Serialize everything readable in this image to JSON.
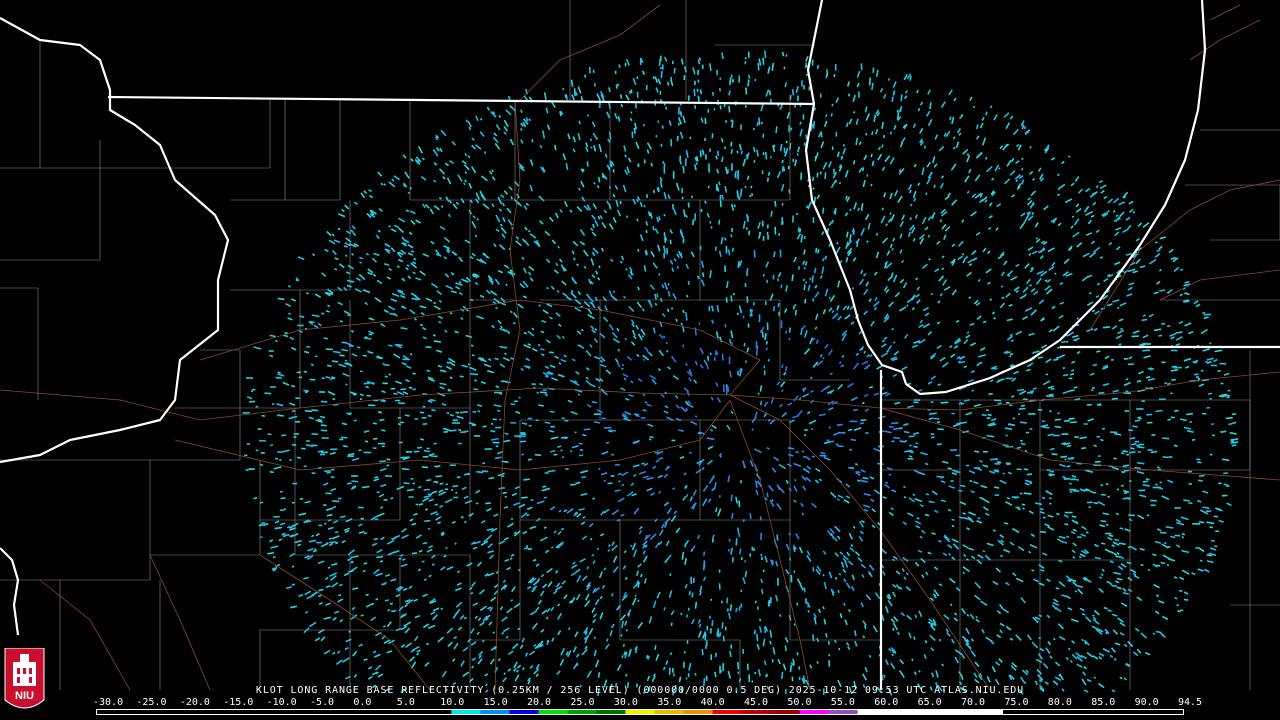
{
  "product": {
    "header": "KLOT LONG RANGE BASE REFLECTIVITY (0.25KM / 256 LEVEL) (000000/0000 0.5 DEG) 2025-10-12 09:53 UTC  ATLAS.NIU.EDU"
  },
  "scale": {
    "labels": [
      "-30.0",
      "-25.0",
      "-20.0",
      "-15.0",
      "-10.0",
      "-5.0",
      "0.0",
      "5.0",
      "10.0",
      "15.0",
      "20.0",
      "25.0",
      "30.0",
      "35.0",
      "40.0",
      "45.0",
      "50.0",
      "55.0",
      "60.0",
      "65.0",
      "70.0",
      "75.0",
      "80.0",
      "85.0",
      "90.0",
      "94.5"
    ],
    "colors": [
      "#000000",
      "#000000",
      "#000000",
      "#000000",
      "#000000",
      "#000000",
      "#00e8e8",
      "#0090f0",
      "#0000f0",
      "#00e000",
      "#00a000",
      "#007000",
      "#f0f000",
      "#e8b800",
      "#f09000",
      "#f00000",
      "#c00000",
      "#a00000",
      "#ff00ff",
      "#9050c0",
      "#ffffff",
      "#ffffff",
      "#ffffff",
      "#ffffff",
      "#ffffff"
    ]
  },
  "radar": {
    "site": "KLOT",
    "echo_colors": [
      "#22d6e6",
      "#1aa8e8",
      "#2f86e6",
      "#3070e0",
      "#1ec0e4"
    ]
  },
  "logo": {
    "text": "NIU",
    "color": "#c8102e"
  }
}
